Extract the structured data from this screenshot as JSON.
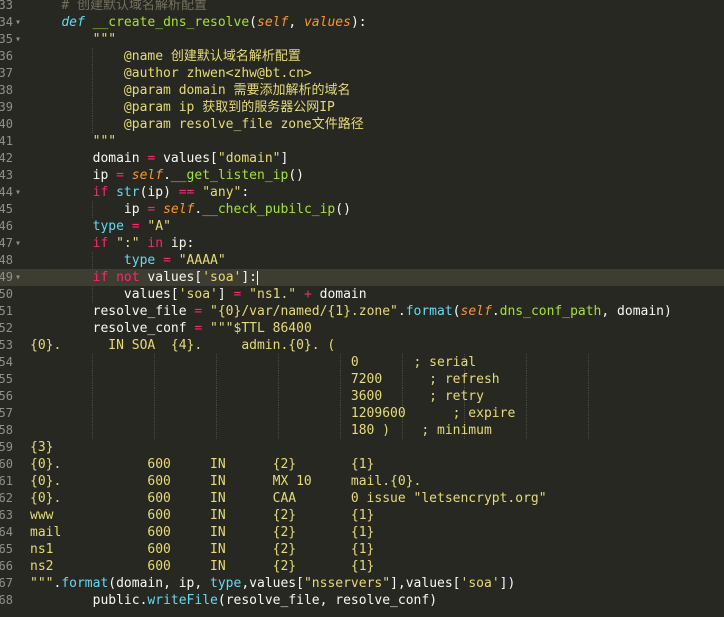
{
  "editor": {
    "lines": [
      {
        "num": "33",
        "fold": "",
        "current": false,
        "guides": [],
        "tokens": [
          {
            "t": "    ",
            "c": ""
          },
          {
            "t": "# 创建默认域名解析配置",
            "c": "cm"
          }
        ]
      },
      {
        "num": "34",
        "fold": "▾",
        "current": false,
        "guides": [],
        "tokens": [
          {
            "t": "    ",
            "c": ""
          },
          {
            "t": "def",
            "c": "df"
          },
          {
            "t": " ",
            "c": ""
          },
          {
            "t": "__create_dns_resolve",
            "c": "fn"
          },
          {
            "t": "(",
            "c": ""
          },
          {
            "t": "self",
            "c": "sf"
          },
          {
            "t": ", ",
            "c": ""
          },
          {
            "t": "values",
            "c": "sf"
          },
          {
            "t": "):",
            "c": ""
          }
        ]
      },
      {
        "num": "35",
        "fold": "▾",
        "current": false,
        "guides": [],
        "tokens": [
          {
            "t": "        ",
            "c": ""
          },
          {
            "t": "\"\"\"",
            "c": "st"
          }
        ]
      },
      {
        "num": "36",
        "fold": "",
        "current": false,
        "guides": [
          8
        ],
        "tokens": [
          {
            "t": "            ",
            "c": ""
          },
          {
            "t": "@name 创建默认域名解析配置",
            "c": "st"
          }
        ]
      },
      {
        "num": "37",
        "fold": "",
        "current": false,
        "guides": [
          8
        ],
        "tokens": [
          {
            "t": "            ",
            "c": ""
          },
          {
            "t": "@author zhwen<zhw@bt.cn>",
            "c": "st"
          }
        ]
      },
      {
        "num": "38",
        "fold": "",
        "current": false,
        "guides": [
          8
        ],
        "tokens": [
          {
            "t": "            ",
            "c": ""
          },
          {
            "t": "@param domain 需要添加解析的域名",
            "c": "st"
          }
        ]
      },
      {
        "num": "39",
        "fold": "",
        "current": false,
        "guides": [
          8
        ],
        "tokens": [
          {
            "t": "            ",
            "c": ""
          },
          {
            "t": "@param ip 获取到的服务器公网IP",
            "c": "st"
          }
        ]
      },
      {
        "num": "40",
        "fold": "",
        "current": false,
        "guides": [
          8
        ],
        "tokens": [
          {
            "t": "            ",
            "c": ""
          },
          {
            "t": "@param resolve_file zone文件路径",
            "c": "st"
          }
        ]
      },
      {
        "num": "41",
        "fold": "",
        "current": false,
        "guides": [],
        "tokens": [
          {
            "t": "        ",
            "c": ""
          },
          {
            "t": "\"\"\"",
            "c": "st"
          }
        ]
      },
      {
        "num": "42",
        "fold": "",
        "current": false,
        "guides": [],
        "tokens": [
          {
            "t": "        ",
            "c": ""
          },
          {
            "t": "domain ",
            "c": ""
          },
          {
            "t": "=",
            "c": "op"
          },
          {
            "t": " values[",
            "c": ""
          },
          {
            "t": "\"domain\"",
            "c": "st"
          },
          {
            "t": "]",
            "c": ""
          }
        ]
      },
      {
        "num": "43",
        "fold": "",
        "current": false,
        "guides": [],
        "tokens": [
          {
            "t": "        ",
            "c": ""
          },
          {
            "t": "ip ",
            "c": ""
          },
          {
            "t": "=",
            "c": "op"
          },
          {
            "t": " ",
            "c": ""
          },
          {
            "t": "self",
            "c": "sf"
          },
          {
            "t": ".",
            "c": ""
          },
          {
            "t": "__get_listen_ip",
            "c": "fn"
          },
          {
            "t": "()",
            "c": ""
          }
        ]
      },
      {
        "num": "44",
        "fold": "▾",
        "current": false,
        "guides": [],
        "tokens": [
          {
            "t": "        ",
            "c": ""
          },
          {
            "t": "if",
            "c": "kw"
          },
          {
            "t": " ",
            "c": ""
          },
          {
            "t": "str",
            "c": "bi"
          },
          {
            "t": "(ip) ",
            "c": ""
          },
          {
            "t": "==",
            "c": "op"
          },
          {
            "t": " ",
            "c": ""
          },
          {
            "t": "\"any\"",
            "c": "st"
          },
          {
            "t": ":",
            "c": ""
          }
        ]
      },
      {
        "num": "45",
        "fold": "",
        "current": false,
        "guides": [
          8
        ],
        "tokens": [
          {
            "t": "            ",
            "c": ""
          },
          {
            "t": "ip ",
            "c": ""
          },
          {
            "t": "=",
            "c": "op"
          },
          {
            "t": " ",
            "c": ""
          },
          {
            "t": "self",
            "c": "sf"
          },
          {
            "t": ".",
            "c": ""
          },
          {
            "t": "__check_pubilc_ip",
            "c": "fn"
          },
          {
            "t": "()",
            "c": ""
          }
        ]
      },
      {
        "num": "46",
        "fold": "",
        "current": false,
        "guides": [],
        "tokens": [
          {
            "t": "        ",
            "c": ""
          },
          {
            "t": "type",
            "c": "bi"
          },
          {
            "t": " ",
            "c": ""
          },
          {
            "t": "=",
            "c": "op"
          },
          {
            "t": " ",
            "c": ""
          },
          {
            "t": "\"A\"",
            "c": "st"
          }
        ]
      },
      {
        "num": "47",
        "fold": "▾",
        "current": false,
        "guides": [],
        "tokens": [
          {
            "t": "        ",
            "c": ""
          },
          {
            "t": "if",
            "c": "kw"
          },
          {
            "t": " ",
            "c": ""
          },
          {
            "t": "\":\"",
            "c": "st"
          },
          {
            "t": " ",
            "c": ""
          },
          {
            "t": "in",
            "c": "kw"
          },
          {
            "t": " ip:",
            "c": ""
          }
        ]
      },
      {
        "num": "48",
        "fold": "",
        "current": false,
        "guides": [
          8
        ],
        "tokens": [
          {
            "t": "            ",
            "c": ""
          },
          {
            "t": "type",
            "c": "bi"
          },
          {
            "t": " ",
            "c": ""
          },
          {
            "t": "=",
            "c": "op"
          },
          {
            "t": " ",
            "c": ""
          },
          {
            "t": "\"AAAA\"",
            "c": "st"
          }
        ]
      },
      {
        "num": "49",
        "fold": "▾",
        "current": true,
        "guides": [],
        "tokens": [
          {
            "t": "        ",
            "c": ""
          },
          {
            "t": "if",
            "c": "kw"
          },
          {
            "t": " ",
            "c": ""
          },
          {
            "t": "not",
            "c": "kw"
          },
          {
            "t": " values[",
            "c": ""
          },
          {
            "t": "'soa'",
            "c": "st"
          },
          {
            "t": "]:",
            "c": ""
          },
          {
            "t": "",
            "c": "cursor"
          }
        ]
      },
      {
        "num": "50",
        "fold": "",
        "current": false,
        "guides": [
          8
        ],
        "tokens": [
          {
            "t": "            ",
            "c": ""
          },
          {
            "t": "values[",
            "c": ""
          },
          {
            "t": "'soa'",
            "c": "st"
          },
          {
            "t": "] ",
            "c": ""
          },
          {
            "t": "=",
            "c": "op"
          },
          {
            "t": " ",
            "c": ""
          },
          {
            "t": "\"ns1.\"",
            "c": "st"
          },
          {
            "t": " ",
            "c": ""
          },
          {
            "t": "+",
            "c": "op"
          },
          {
            "t": " domain",
            "c": ""
          }
        ]
      },
      {
        "num": "51",
        "fold": "",
        "current": false,
        "guides": [],
        "tokens": [
          {
            "t": "        ",
            "c": ""
          },
          {
            "t": "resolve_file ",
            "c": ""
          },
          {
            "t": "=",
            "c": "op"
          },
          {
            "t": " ",
            "c": ""
          },
          {
            "t": "\"{0}/var/named/{1}.zone\"",
            "c": "st"
          },
          {
            "t": ".",
            "c": ""
          },
          {
            "t": "format",
            "c": "bi"
          },
          {
            "t": "(",
            "c": ""
          },
          {
            "t": "self",
            "c": "sf"
          },
          {
            "t": ".",
            "c": ""
          },
          {
            "t": "dns_conf_path",
            "c": "fn"
          },
          {
            "t": ", domain)",
            "c": ""
          }
        ]
      },
      {
        "num": "52",
        "fold": "",
        "current": false,
        "guides": [],
        "tokens": [
          {
            "t": "        ",
            "c": ""
          },
          {
            "t": "resolve_conf ",
            "c": ""
          },
          {
            "t": "=",
            "c": "op"
          },
          {
            "t": " ",
            "c": ""
          },
          {
            "t": "\"\"\"$TTL 86400",
            "c": "st"
          }
        ]
      },
      {
        "num": "53",
        "fold": "",
        "current": false,
        "guides": [],
        "tokens": [
          {
            "t": "{0}.      IN SOA  {4}.     admin.{0}. (",
            "c": "st"
          }
        ]
      },
      {
        "num": "54",
        "fold": "",
        "current": false,
        "guides": [
          8,
          16,
          24,
          32,
          40,
          48,
          56,
          64,
          72
        ],
        "tokens": [
          {
            "t": "                                         ",
            "c": ""
          },
          {
            "t": "0       ; serial",
            "c": "st"
          }
        ]
      },
      {
        "num": "55",
        "fold": "",
        "current": false,
        "guides": [
          8,
          16,
          24,
          32,
          40,
          48,
          56,
          64,
          72
        ],
        "tokens": [
          {
            "t": "                                         ",
            "c": ""
          },
          {
            "t": "7200      ; refresh",
            "c": "st"
          }
        ]
      },
      {
        "num": "56",
        "fold": "",
        "current": false,
        "guides": [
          8,
          16,
          24,
          32,
          40,
          48,
          56,
          64,
          72
        ],
        "tokens": [
          {
            "t": "                                         ",
            "c": ""
          },
          {
            "t": "3600      ; retry",
            "c": "st"
          }
        ]
      },
      {
        "num": "57",
        "fold": "",
        "current": false,
        "guides": [
          8,
          16,
          24,
          32,
          40,
          48,
          56,
          64,
          72
        ],
        "tokens": [
          {
            "t": "                                         ",
            "c": ""
          },
          {
            "t": "1209600      ; expire",
            "c": "st"
          }
        ]
      },
      {
        "num": "58",
        "fold": "",
        "current": false,
        "guides": [
          8,
          16,
          24,
          32,
          40,
          48,
          56,
          64,
          72
        ],
        "tokens": [
          {
            "t": "                                         ",
            "c": ""
          },
          {
            "t": "180 )    ; minimum",
            "c": "st"
          }
        ]
      },
      {
        "num": "59",
        "fold": "",
        "current": false,
        "guides": [],
        "tokens": [
          {
            "t": "{3}",
            "c": "st"
          }
        ]
      },
      {
        "num": "60",
        "fold": "",
        "current": false,
        "guides": [],
        "tokens": [
          {
            "t": "{0}.           600     IN      {2}       {1}",
            "c": "st"
          }
        ]
      },
      {
        "num": "61",
        "fold": "",
        "current": false,
        "guides": [],
        "tokens": [
          {
            "t": "{0}.           600     IN      MX 10     mail.{0}.",
            "c": "st"
          }
        ]
      },
      {
        "num": "62",
        "fold": "",
        "current": false,
        "guides": [],
        "tokens": [
          {
            "t": "{0}.           600     IN      CAA       0 issue \"letsencrypt.org\"",
            "c": "st"
          }
        ]
      },
      {
        "num": "63",
        "fold": "",
        "current": false,
        "guides": [],
        "tokens": [
          {
            "t": "www            600     IN      {2}       {1}",
            "c": "st"
          }
        ]
      },
      {
        "num": "64",
        "fold": "",
        "current": false,
        "guides": [],
        "tokens": [
          {
            "t": "mail           600     IN      {2}       {1}",
            "c": "st"
          }
        ]
      },
      {
        "num": "65",
        "fold": "",
        "current": false,
        "guides": [],
        "tokens": [
          {
            "t": "ns1            600     IN      {2}       {1}",
            "c": "st"
          }
        ]
      },
      {
        "num": "66",
        "fold": "",
        "current": false,
        "guides": [],
        "tokens": [
          {
            "t": "ns2            600     IN      {2}       {1}",
            "c": "st"
          }
        ]
      },
      {
        "num": "67",
        "fold": "",
        "current": false,
        "guides": [],
        "tokens": [
          {
            "t": "\"\"\"",
            "c": "st"
          },
          {
            "t": ".",
            "c": ""
          },
          {
            "t": "format",
            "c": "bi"
          },
          {
            "t": "(domain, ip, ",
            "c": ""
          },
          {
            "t": "type",
            "c": "bi"
          },
          {
            "t": ",values[",
            "c": ""
          },
          {
            "t": "\"nsservers\"",
            "c": "st"
          },
          {
            "t": "],values[",
            "c": ""
          },
          {
            "t": "'soa'",
            "c": "st"
          },
          {
            "t": "])",
            "c": ""
          }
        ]
      },
      {
        "num": "68",
        "fold": "",
        "current": false,
        "guides": [],
        "tokens": [
          {
            "t": "        ",
            "c": ""
          },
          {
            "t": "public",
            "c": ""
          },
          {
            "t": ".",
            "c": ""
          },
          {
            "t": "writeFile",
            "c": "bi"
          },
          {
            "t": "(resolve_file, resolve_conf)",
            "c": ""
          }
        ]
      }
    ]
  }
}
